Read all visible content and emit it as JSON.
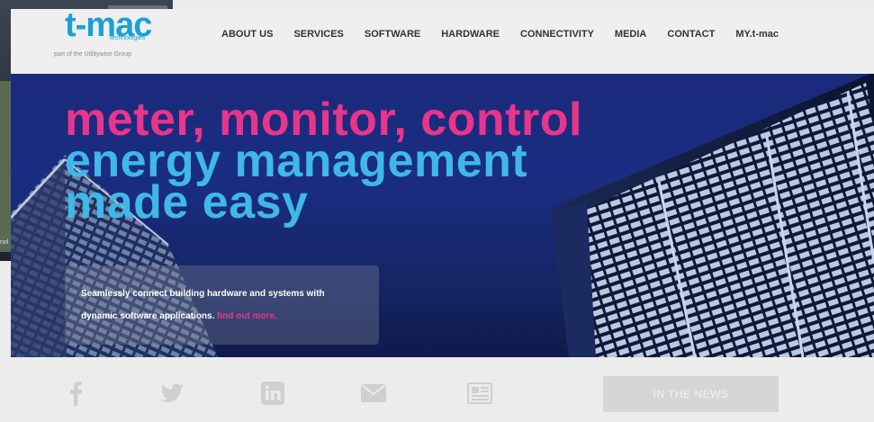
{
  "background_window": {
    "label": "nol"
  },
  "header": {
    "logo": "t-mac",
    "logo_sub": "technologies",
    "tagline": "part of the Utilitywise Group",
    "nav": [
      "ABOUT US",
      "SERVICES",
      "SOFTWARE",
      "HARDWARE",
      "CONNECTIVITY",
      "MEDIA",
      "CONTACT",
      "MY.t-mac"
    ]
  },
  "hero": {
    "line1": "meter, monitor, control",
    "line2": "energy management",
    "line3": "made easy",
    "callout_line1": "Seamlessly connect building hardware and systems with",
    "callout_line2": "dynamic software applications.",
    "callout_link": "find out more."
  },
  "footer": {
    "social_icons": [
      "facebook-icon",
      "twitter-icon",
      "linkedin-icon",
      "email-icon",
      "newsletter-icon"
    ],
    "news_button": "IN THE NEWS"
  },
  "colors": {
    "brand_blue": "#1aa0d8",
    "accent_pink": "#e8358c",
    "hero_blue": "#3fb8e8",
    "hero_bg": "#1a2d82",
    "icon_grey": "#cfcfcf"
  }
}
